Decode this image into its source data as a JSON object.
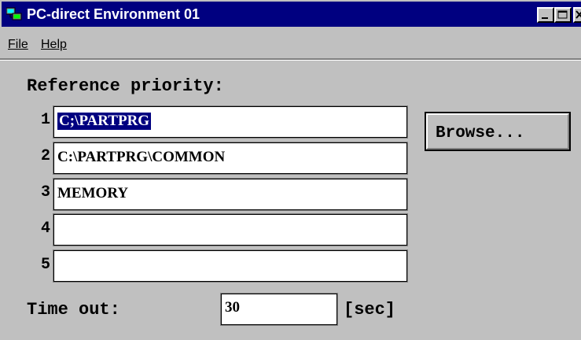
{
  "window": {
    "title": "PC-direct Environment 01",
    "titlebar_color": "#000080"
  },
  "menu": {
    "file": "File",
    "help": "Help"
  },
  "reference": {
    "label": "Reference priority:",
    "rows": [
      {
        "num": "1",
        "value": "C;\\PARTPRG",
        "selected": true
      },
      {
        "num": "2",
        "value": "C:\\PARTPRG\\COMMON"
      },
      {
        "num": "3",
        "value": "MEMORY"
      },
      {
        "num": "4",
        "value": ""
      },
      {
        "num": "5",
        "value": ""
      }
    ]
  },
  "browse": {
    "label": "Browse..."
  },
  "timeout": {
    "label": "Time out:",
    "value": "30",
    "unit": "[sec]"
  },
  "icons": [
    "app-icon",
    "minimize-icon",
    "maximize-icon",
    "close-icon"
  ]
}
